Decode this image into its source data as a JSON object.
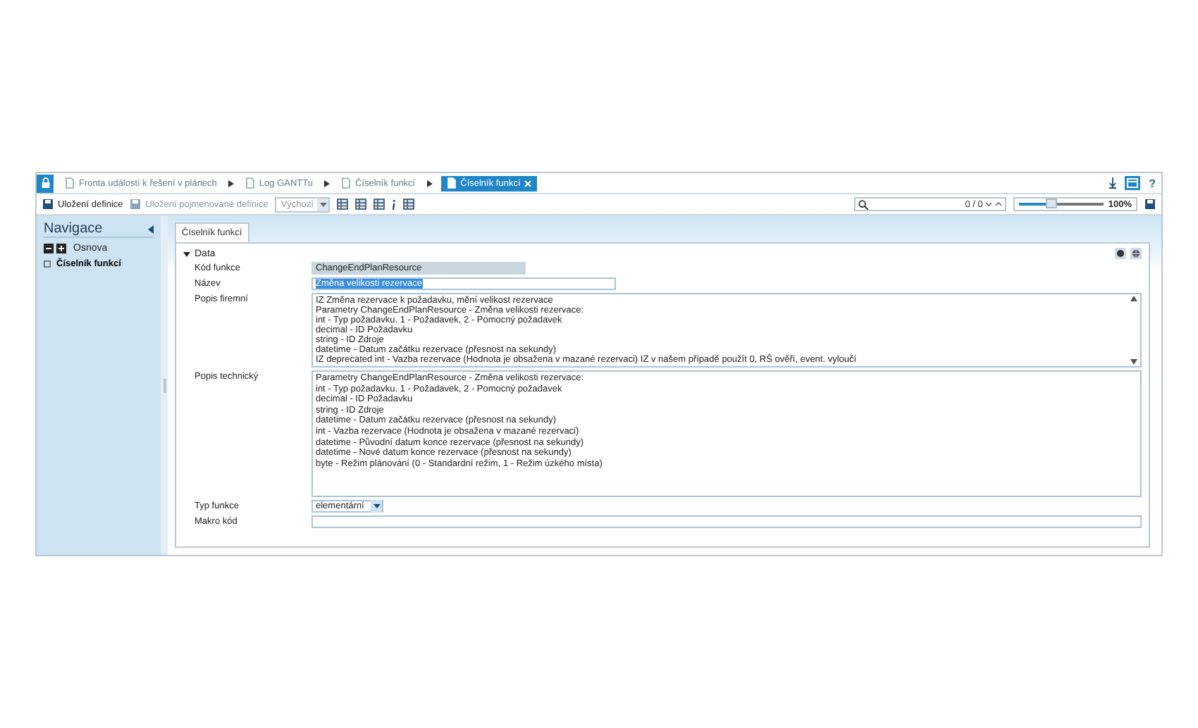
{
  "breadcrumbs": [
    {
      "label": "Fronta událostí k řešení v plánech",
      "selected": false
    },
    {
      "label": "Log GANTTu",
      "selected": false
    },
    {
      "label": "Číselník funkcí",
      "selected": false
    },
    {
      "label": "Číselník funkcí",
      "selected": true
    }
  ],
  "help": "?",
  "toolbar": {
    "save": "Uložení definice",
    "save_named": "Uložení pojmenované definice",
    "view_select": "Výchozí",
    "search_counter": "0 / 0",
    "zoom": {
      "level": 0.37,
      "reading": "100%"
    }
  },
  "navigation": {
    "title": "Navigace",
    "outline": "Osnova",
    "items": [
      {
        "label": "Číselník funkcí",
        "selected": true
      }
    ]
  },
  "tabs": [
    {
      "label": "Číselník funkcí",
      "selected": true
    }
  ],
  "section": {
    "title": "Data",
    "expanded": true
  },
  "fields": [
    {
      "kind": "readonly",
      "label": "Kód funkce",
      "value": "ChangeEndPlanResource"
    },
    {
      "kind": "text",
      "label": "Název",
      "value": "Změna velikosti rezervace",
      "highlighted": true
    },
    {
      "kind": "memo",
      "label": "Popis firemní",
      "scrollbar": true,
      "lines": [
        "IZ Změna rezervace k požadavku, mění velikost rezervace",
        "Parametry ChangeEndPlanResource - Změna velikosti rezervace:",
        "int - Typ požadavku. 1 - Požadavek, 2 - Pomocný požadavek",
        "decimal - ID Požadavku",
        "string - ID Zdroje",
        "datetime - Datum začátku rezervace (přesnost na sekundy)",
        "IZ deprecated int - Vazba rezervace (Hodnota je obsažena v mazané rezervaci) IZ v našem případě použít 0, RŠ ověří, event. vyloučí"
      ]
    },
    {
      "kind": "memo",
      "label": "Popis technický",
      "scrollbar": false,
      "lines": [
        "Parametry ChangeEndPlanResource - Změna velikosti rezervace:",
        "int - Typ požadavku. 1 - Požadavek, 2 - Pomocný požadavek",
        "decimal - ID Požadavku",
        "string - ID Zdroje",
        "datetime - Datum začátku rezervace (přesnost na sekundy)",
        "int - Vazba rezervace (Hodnota je obsažena v mazané rezervaci)",
        "datetime - Původní datum konce rezervace (přesnost na sekundy)",
        "datetime - Nové datum konce rezervace (přesnost na sekundy)",
        "byte - Režim plánování (0 - Standardní režim, 1 - Režim úzkého místa)"
      ]
    },
    {
      "kind": "select",
      "label": "Typ funkce",
      "value": "elementární"
    },
    {
      "kind": "text",
      "label": "Makro kód"
    }
  ]
}
